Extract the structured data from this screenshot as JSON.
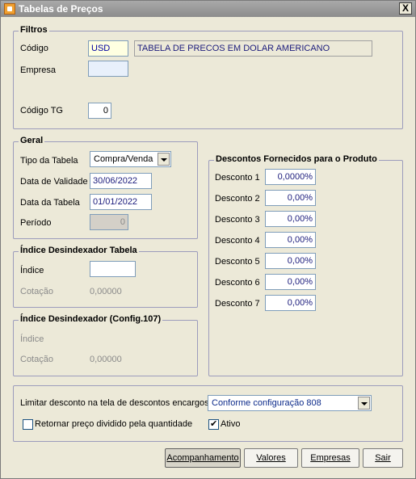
{
  "window": {
    "title": "Tabelas de Preços",
    "close_label": "X",
    "icon": "app-icon"
  },
  "filtros": {
    "title": "Filtros",
    "codigo_label": "Código",
    "codigo_value": "USD",
    "descricao_value": "TABELA DE PRECOS EM DOLAR AMERICANO",
    "empresa_label": "Empresa",
    "empresa_value": "",
    "codigo_tg_label": "Código TG",
    "codigo_tg_value": "0"
  },
  "geral": {
    "title": "Geral",
    "tipo_label": "Tipo da Tabela",
    "tipo_value": "Compra/Venda",
    "validade_label": "Data de Validade",
    "validade_value": "30/06/2022",
    "data_tabela_label": "Data da Tabela",
    "data_tabela_value": "01/01/2022",
    "periodo_label": "Período",
    "periodo_value": "0"
  },
  "indice_tabela": {
    "title": "Índice Desindexador Tabela",
    "indice_label": "Índice",
    "indice_value": "",
    "cotacao_label": "Cotação",
    "cotacao_value": "0,00000"
  },
  "indice_config": {
    "title": "Índice Desindexador (Config.107)",
    "indice_label": "Índice",
    "cotacao_label": "Cotação",
    "cotacao_value": "0,00000"
  },
  "descontos": {
    "title": "Descontos Fornecidos para o Produto",
    "items": [
      {
        "label": "Desconto 1",
        "value": "0,0000%"
      },
      {
        "label": "Desconto 2",
        "value": "0,00%"
      },
      {
        "label": "Desconto 3",
        "value": "0,00%"
      },
      {
        "label": "Desconto 4",
        "value": "0,00%"
      },
      {
        "label": "Desconto 5",
        "value": "0,00%"
      },
      {
        "label": "Desconto 6",
        "value": "0,00%"
      },
      {
        "label": "Desconto 7",
        "value": "0,00%"
      }
    ]
  },
  "opcoes": {
    "limitar_label": "Limitar desconto na tela de descontos encargos",
    "limitar_value": "Conforme configuração 808",
    "retornar_label": "Retornar preço dividido pela quantidade",
    "retornar_checked": false,
    "ativo_label": "Ativo",
    "ativo_checked": true
  },
  "buttons": {
    "acompanhamento": "Acompanhamento",
    "valores": "Valores",
    "empresas": "Empresas",
    "sair": "Sair"
  }
}
